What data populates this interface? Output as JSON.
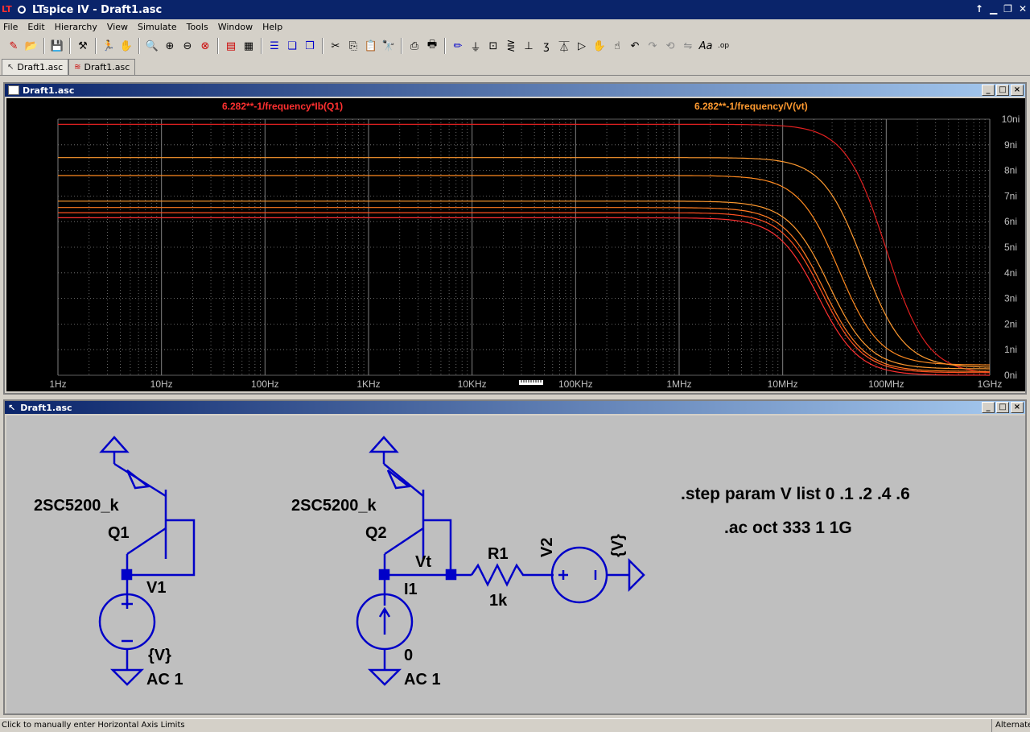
{
  "window": {
    "title": "LTspice IV - Draft1.asc"
  },
  "menu": [
    "File",
    "Edit",
    "Hierarchy",
    "View",
    "Simulate",
    "Tools",
    "Window",
    "Help"
  ],
  "tabs": [
    {
      "label": "Draft1.asc",
      "icon": "schematic-icon"
    },
    {
      "label": "Draft1.asc",
      "icon": "waveform-icon"
    }
  ],
  "plot_window": {
    "title": "Draft1.asc"
  },
  "schematic_window": {
    "title": "Draft1.asc"
  },
  "colors": {
    "trace1": "#ff3030",
    "trace2": "#ff9a30",
    "schematic_wire": "#0000c8",
    "grid": "#808080"
  },
  "chart_data": {
    "type": "line",
    "xscale": "log",
    "xlim": [
      1,
      1000000000
    ],
    "ylim": [
      0,
      10
    ],
    "grid": true,
    "x_ticks": [
      "1Hz",
      "10Hz",
      "100Hz",
      "1KHz",
      "10KHz",
      "100KHz",
      "1MHz",
      "10MHz",
      "100MHz",
      "1GHz"
    ],
    "y_ticks": [
      "0ni",
      "1ni",
      "2ni",
      "3ni",
      "4ni",
      "5ni",
      "6ni",
      "7ni",
      "8ni",
      "9ni",
      "10ni"
    ],
    "series_labels": [
      {
        "text": "6.282**-1/frequency*Ib(Q1)",
        "color": "#ff3030"
      },
      {
        "text": "6.282**-1/frequency/V(vt)",
        "color": "#ff9a30"
      }
    ],
    "series": [
      {
        "plateau": 9.8,
        "corner_hz": 100000000,
        "floor": 0.05,
        "color": "#e02020"
      },
      {
        "plateau": 8.5,
        "corner_hz": 60000000,
        "floor": 0.3,
        "color": "#ff9a30"
      },
      {
        "plateau": 7.8,
        "corner_hz": 35000000,
        "floor": 0.4,
        "color": "#ff8a20"
      },
      {
        "plateau": 6.8,
        "corner_hz": 28000000,
        "floor": 0.25,
        "color": "#ff9a30"
      },
      {
        "plateau": 6.55,
        "corner_hz": 25000000,
        "floor": 0.15,
        "color": "#ff7a20"
      },
      {
        "plateau": 6.35,
        "corner_hz": 24000000,
        "floor": 0.1,
        "color": "#ff5020"
      },
      {
        "plateau": 6.15,
        "corner_hz": 22000000,
        "floor": 0.0,
        "color": "#ff3030"
      }
    ]
  },
  "schematic": {
    "q1_model": "2SC5200_k",
    "q1_name": "Q1",
    "v1_name": "V1",
    "v1_value": "{V}",
    "v1_ac": "AC 1",
    "q2_model": "2SC5200_k",
    "q2_name": "Q2",
    "net_label": "Vt",
    "i1_name": "I1",
    "i1_value": "0",
    "i1_ac": "AC 1",
    "r1_name": "R1",
    "r1_value": "1k",
    "v2_name": "V2",
    "v2_value": "{V}",
    "step_directive": ".step param V list 0 .1 .2 .4 .6",
    "ac_directive": ".ac oct 333 1 1G"
  },
  "status": {
    "left": "Click to manually enter Horizontal Axis Limits",
    "right": "Alternate"
  }
}
